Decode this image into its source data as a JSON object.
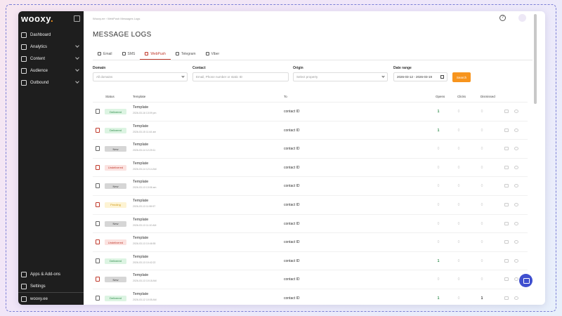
{
  "sidebar": {
    "logo": "wooxy",
    "logo_dot": ".",
    "items": [
      {
        "label": "Dashboard",
        "icon": "dashboard-icon",
        "expandable": false
      },
      {
        "label": "Analytics",
        "icon": "analytics-icon",
        "expandable": true
      },
      {
        "label": "Content",
        "icon": "content-icon",
        "expandable": true
      },
      {
        "label": "Audience",
        "icon": "audience-icon",
        "expandable": true
      },
      {
        "label": "Outbound",
        "icon": "outbound-icon",
        "expandable": true
      }
    ],
    "bottom_items": [
      {
        "label": "Apps & Add-ons",
        "icon": "apps-icon"
      },
      {
        "label": "Settings",
        "icon": "settings-icon"
      },
      {
        "label": "wooxy.ee",
        "icon": "workspace-icon"
      }
    ]
  },
  "header": {
    "breadcrumb": "Wooxy.ee  ›  WebPush Messages Logs",
    "help_icon": "?"
  },
  "page_title": "MESSAGE LOGS",
  "tabs": [
    {
      "label": "Email",
      "icon": "email-icon",
      "active": false
    },
    {
      "label": "SMS",
      "icon": "sms-icon",
      "active": false
    },
    {
      "label": "WebPush",
      "icon": "webpush-icon",
      "active": true
    },
    {
      "label": "Telegram",
      "icon": "telegram-icon",
      "active": false
    },
    {
      "label": "Viber",
      "icon": "viber-icon",
      "active": false
    }
  ],
  "filters": {
    "domain": {
      "label": "Domain",
      "placeholder": "All domains"
    },
    "contact": {
      "label": "Contact",
      "placeholder": "Email, Phone number or static ID"
    },
    "origin": {
      "label": "Origin",
      "placeholder": "Select property"
    },
    "date_range": {
      "label": "Date range",
      "value": "2026-03-12 - 2026-03-19"
    },
    "search_label": "Search"
  },
  "table": {
    "columns": {
      "status": "Status",
      "template": "Template",
      "to": "To",
      "opens": "Opens",
      "clicks": "Clicks",
      "dismissed": "Dismissed"
    },
    "rows": [
      {
        "channel": "email",
        "status": "Delivered",
        "status_type": "delivered",
        "template": "Template",
        "date": "2026-03-16 13:09 pm",
        "to": "contact ID",
        "opens": "1",
        "clicks": "0",
        "dismissed": "0"
      },
      {
        "channel": "webpush",
        "status": "Delivered",
        "status_type": "delivered",
        "template": "Template",
        "date": "2026-03-15 11:44 am",
        "to": "contact ID",
        "opens": "1",
        "clicks": "0",
        "dismissed": "0"
      },
      {
        "channel": "email",
        "status": "New",
        "status_type": "new",
        "template": "Template",
        "date": "2026-03-14 12:29:11",
        "to": "contact ID",
        "opens": "0",
        "clicks": "0",
        "dismissed": "0"
      },
      {
        "channel": "webpush",
        "status": "Undelivered",
        "status_type": "undelivered",
        "template": "Template",
        "date": "2026-03-14 12:14 AM",
        "to": "contact ID",
        "opens": "0",
        "clicks": "0",
        "dismissed": "0"
      },
      {
        "channel": "email",
        "status": "New",
        "status_type": "new",
        "template": "Template",
        "date": "2026-03-13 13:06 am",
        "to": "contact ID",
        "opens": "0",
        "clicks": "0",
        "dismissed": "0"
      },
      {
        "channel": "webpush",
        "status": "Pending",
        "status_type": "pending",
        "template": "Template",
        "date": "2026-03-13 11:59:57",
        "to": "contact ID",
        "opens": "0",
        "clicks": "0",
        "dismissed": "0"
      },
      {
        "channel": "email",
        "status": "New",
        "status_type": "new",
        "template": "Template",
        "date": "2026-03-13 11:10 AM",
        "to": "contact ID",
        "opens": "0",
        "clicks": "0",
        "dismissed": "0"
      },
      {
        "channel": "webpush",
        "status": "Undelivered",
        "status_type": "undelivered",
        "template": "Template",
        "date": "2026-03-13 10:46:55",
        "to": "contact ID",
        "opens": "0",
        "clicks": "0",
        "dismissed": "0"
      },
      {
        "channel": "email",
        "status": "Delivered",
        "status_type": "delivered",
        "template": "Template",
        "date": "2026-03-13 10:42:22",
        "to": "contact ID",
        "opens": "1",
        "clicks": "0",
        "dismissed": "0"
      },
      {
        "channel": "webpush",
        "status": "New",
        "status_type": "new",
        "template": "Template",
        "date": "2026-03-13 10:18 AM",
        "to": "contact ID",
        "opens": "0",
        "clicks": "0",
        "dismissed": "0"
      },
      {
        "channel": "email",
        "status": "Delivered",
        "status_type": "delivered",
        "template": "Template",
        "date": "2026-03-12 10:05 AM",
        "to": "contact ID",
        "opens": "1",
        "clicks": "0",
        "dismissed": "1"
      }
    ]
  },
  "colors": {
    "accent": "#f7941d",
    "active_tab": "#c0392b",
    "sidebar_bg": "#1e1e1e",
    "chat_button": "#3f4fcf"
  }
}
